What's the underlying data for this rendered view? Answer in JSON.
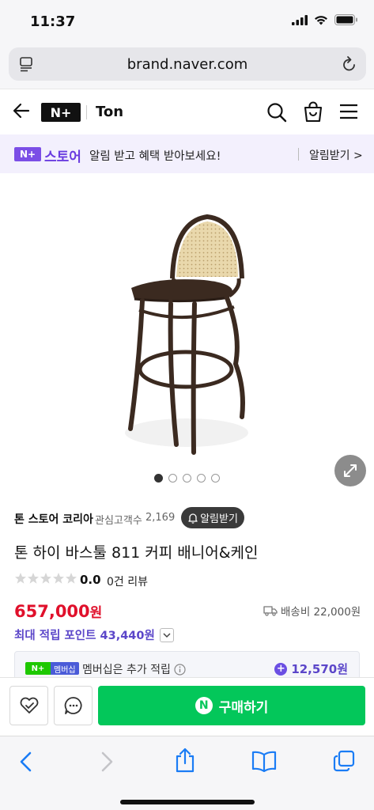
{
  "status_bar": {
    "time": "11:37"
  },
  "browser": {
    "url": "brand.naver.com"
  },
  "header": {
    "logo_text": "N+",
    "brand_name": "Ton"
  },
  "store_banner": {
    "badge": "N+",
    "store_label": "스토어",
    "message": "알림 받고 혜택 받아보세요!",
    "alarm_link": "알림받기 >"
  },
  "gallery": {
    "image_count": 5,
    "active_index": 0
  },
  "seller": {
    "name": "톤 스토어 코리아",
    "followers_label": "관심고객수",
    "followers_count": "2,169",
    "alarm_button": "알림받기"
  },
  "product": {
    "title": "톤 하이 바스툴 811 커피 배니어&케인",
    "rating": "0.0",
    "review_count": "0건 리뷰",
    "stars_filled": 0,
    "price": "657,000",
    "price_unit": "원",
    "shipping": "배송비 22,000원",
    "points_label": "최대 적립 포인트 43,440원"
  },
  "membership": {
    "badge_np": "N+",
    "badge_label": "멤버십",
    "text": "멤버십은 추가 적립",
    "points": "12,570원"
  },
  "buy_bar": {
    "buy_label": "구매하기",
    "buy_logo": "N"
  },
  "colors": {
    "price_red": "#e0102b",
    "naver_green": "#03c75a",
    "store_purple": "#6a3ce0",
    "points_purple": "#5b46c9",
    "safari_blue": "#1a7cf5"
  }
}
